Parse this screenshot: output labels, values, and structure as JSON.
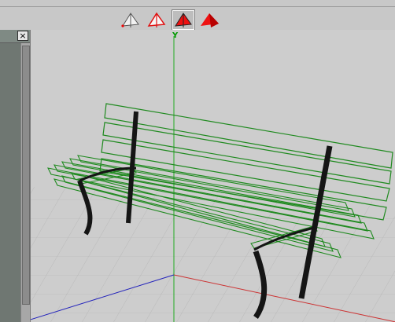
{
  "toolbar": {
    "modes": [
      {
        "name": "wireframe",
        "active": false
      },
      {
        "name": "hidden-line",
        "active": false
      },
      {
        "name": "shaded",
        "active": true
      },
      {
        "name": "smooth-shaded",
        "active": false
      }
    ]
  },
  "panel": {
    "close_label": "×"
  },
  "viewport": {
    "axis_label": "Y",
    "colors": {
      "grid": "#b4b4b4",
      "bench_slats": "#1f8a1f",
      "bench_frame": "#151515",
      "y_axis": "#22aa22",
      "x_axis": "#cc3333",
      "z_axis": "#2222bb"
    }
  }
}
